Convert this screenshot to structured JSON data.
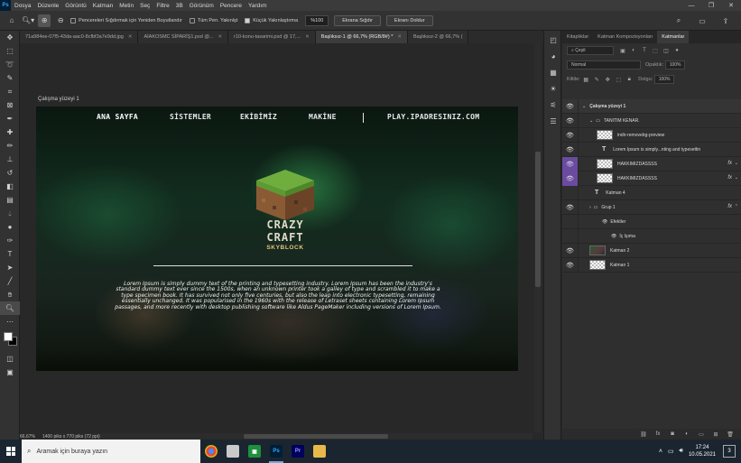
{
  "app": {
    "logo": "Ps",
    "menu": [
      "Dosya",
      "Düzenle",
      "Görüntü",
      "Katman",
      "Metin",
      "Seç",
      "Filtre",
      "3B",
      "Görünüm",
      "Pencere",
      "Yardım"
    ]
  },
  "options": {
    "resize_windows": "Pencereleri Sığdırmak için Yeniden Boyutlandır",
    "zoom_all": "Tüm Pen. Yakınlşt",
    "scrubby_zoom": "Küçük Yakınlaştırma",
    "zoom_value": "%100",
    "fit_screen": "Ekrana Sığdır",
    "fill_screen": "Ekranı Doldur"
  },
  "tabs": [
    {
      "label": "71a984ee-07f5-43da-aac0-8cfbf3a7e9dd.jpg",
      "active": false
    },
    {
      "label": "AİAKOSMC SİPARİŞ1.psd @...",
      "active": false
    },
    {
      "label": "r10-konu-tasarimi.psd @ 17,...",
      "active": false
    },
    {
      "label": "Başlıksız-1 @ 66,7% (RGB/8#) *",
      "active": true
    },
    {
      "label": "Başlıksız-2 @ 66,7% (",
      "active": false
    }
  ],
  "artboard_label": "Çalışma yüzeyi 1",
  "site": {
    "nav": [
      "ANA SAYFA",
      "SİSTEMLER",
      "EKİBİMİZ",
      "MAKİNE",
      "PLAY.IPADRESINIZ.COM"
    ],
    "logo_line1": "CRAZY",
    "logo_line2": "CRAFT",
    "logo_line3": "SKYBLOCK",
    "lorem": "Lorem Ipsum is simply dummy text of the printing and typesetting industry. Lorem Ipsum has been the industry's standard dummy text ever since the 1500s, when an unknown printer took a galley of type and scrambled it to make a type specimen book. It has survived not only five centuries, but also the leap into electronic typesetting, remaining essentially unchanged. It was popularised in the 1960s with the release of Letraset sheets containing Lorem Ipsum passages, and more recently with desktop publishing software like Aldus PageMaker including versions of Lorem Ipsum."
  },
  "status": {
    "zoom": "66,67%",
    "doc_size": "1400 piks x 770 piks (72 ppi)"
  },
  "panel": {
    "tabs": [
      "Kitaplıklar",
      "Katman Kompozisyonları",
      "Katmanlar"
    ],
    "filter": "Çeşit",
    "blend": "Normal",
    "opacity_label": "Opaklık:",
    "opacity_value": "100%",
    "lock_label": "Kilitle:",
    "fill_label": "Dolgu:",
    "fill_value": "100%",
    "layers": [
      {
        "name": "Çalışma yüzeyi 1",
        "kind": "artboard",
        "indent": 0,
        "fx": false
      },
      {
        "name": "TANITIM KENAR.",
        "kind": "folder",
        "indent": 1,
        "fx": false
      },
      {
        "name": "indir-removebg-preview",
        "kind": "thumb",
        "indent": 2,
        "fx": false
      },
      {
        "name": "Lorem Ipsum is simply...nting and typesettin",
        "kind": "text",
        "indent": 2,
        "fx": false
      },
      {
        "name": "HAKKIMIZDASSSS",
        "kind": "thumb",
        "indent": 2,
        "fx": true,
        "purple": true
      },
      {
        "name": "HAKKIMIZDASSSS",
        "kind": "thumb",
        "indent": 2,
        "fx": true,
        "purple": true
      },
      {
        "name": "Katman 4",
        "kind": "text",
        "indent": 1,
        "fx": false,
        "hidden": true
      },
      {
        "name": "Grup 1",
        "kind": "folder",
        "indent": 1,
        "fx": true
      },
      {
        "name": "Efektler",
        "kind": "effect",
        "indent": 2,
        "fx": false
      },
      {
        "name": "İç Işıma",
        "kind": "effect",
        "indent": 3,
        "fx": false
      },
      {
        "name": "Katman 2",
        "kind": "image",
        "indent": 1,
        "fx": false
      },
      {
        "name": "Katman 1",
        "kind": "thumb",
        "indent": 1,
        "fx": false
      }
    ]
  },
  "taskbar": {
    "search_placeholder": "Aramak için buraya yazın",
    "time": "17:24",
    "date": "10.05.2021",
    "notif_count": "3"
  },
  "colors": {
    "accent": "#31a8ff",
    "layer_purple": "#6a4ba0"
  }
}
